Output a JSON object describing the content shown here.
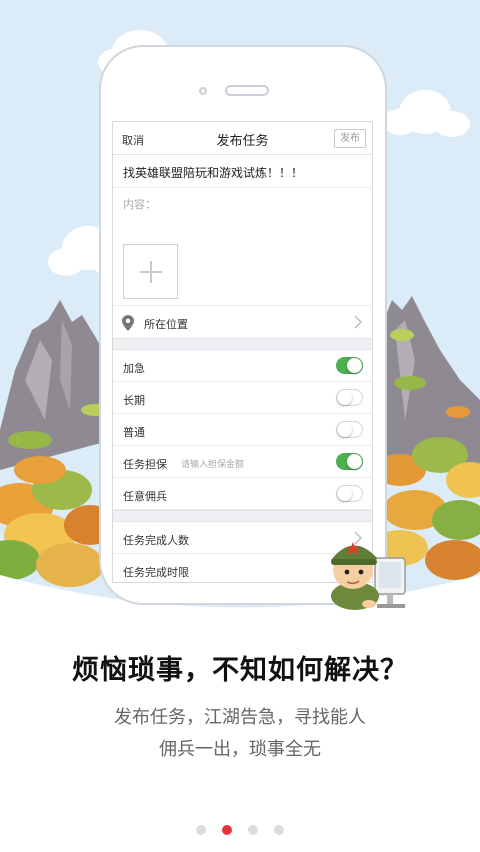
{
  "nav": {
    "cancel": "取消",
    "title": "发布任务",
    "publish": "发布"
  },
  "task_title": "找英雄联盟陪玩和游戏试炼！！！",
  "content_label": "内容：",
  "location": {
    "label": "所在位置",
    "icon": "map-pin-icon"
  },
  "options": [
    {
      "label": "加急",
      "on": true
    },
    {
      "label": "长期",
      "on": false
    },
    {
      "label": "普通",
      "on": false
    },
    {
      "label": "任务担保",
      "hint": "请输入担保金额",
      "on": true
    },
    {
      "label": "任意佣兵",
      "on": false
    }
  ],
  "more": {
    "count_label": "任务完成人数",
    "time_label": "任务完成时限"
  },
  "headline": "烦恼琐事，不知如何解决？",
  "subtitle_1": "发布任务，江湖告急，寻找能人",
  "subtitle_2": "佣兵一出，琐事全无",
  "pager": {
    "count": 4,
    "active_index": 1
  },
  "colors": {
    "toggle_on": "#4cb04f",
    "dot_active": "#e8323c",
    "sky": "#dcebf8"
  }
}
